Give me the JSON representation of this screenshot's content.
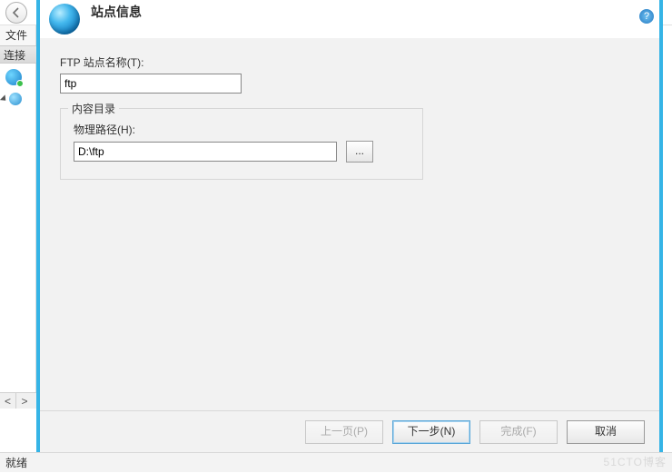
{
  "parent": {
    "menu_file": "文件",
    "connections": "连接",
    "status": "就绪",
    "scroll_left": "<",
    "scroll_right": ">"
  },
  "dialog": {
    "title": "站点信息",
    "help_glyph": "?",
    "site_name_label": "FTP 站点名称(T):",
    "site_name_value": "ftp",
    "fieldset_legend": "内容目录",
    "path_label": "物理路径(H):",
    "path_value": "D:\\ftp",
    "browse_label": "...",
    "buttons": {
      "prev": "上一页(P)",
      "next": "下一步(N)",
      "finish": "完成(F)",
      "cancel": "取消"
    }
  },
  "watermark": "51CTO博客"
}
